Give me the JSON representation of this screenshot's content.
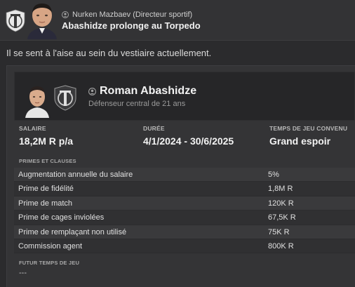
{
  "header": {
    "sender": "Nurken Mazbaev  (Directeur sportif)",
    "subject": "Abashidze prolonge au Torpedo"
  },
  "intro": "Il se sent à l'aise au sein du vestiaire actuellement.",
  "player": {
    "name": "Roman Abashidze",
    "description": "Défenseur central de 21 ans"
  },
  "contract": {
    "salary_label": "SALAIRE",
    "salary_value": "18,2M R p/a",
    "duration_label": "DURÉE",
    "duration_value": "4/1/2024 - 30/6/2025",
    "playtime_label": "TEMPS DE JEU CONVENU",
    "playtime_value": "Grand espoir"
  },
  "clauses": {
    "section_label": "PRIMES ET CLAUSES",
    "rows": [
      {
        "name": "Augmentation annuelle du salaire",
        "value": "5%"
      },
      {
        "name": "Prime de fidélité",
        "value": "1,8M R"
      },
      {
        "name": "Prime de match",
        "value": "120K R"
      },
      {
        "name": "Prime de cages inviolées",
        "value": "67,5K R"
      },
      {
        "name": "Prime de remplaçant non utilisé",
        "value": "75K R"
      },
      {
        "name": "Commission agent",
        "value": "800K R"
      }
    ]
  },
  "future": {
    "label": "FUTUR TEMPS DE JEU",
    "value": "---"
  },
  "icons": {
    "club_badge": "torpedo-club-badge",
    "person": "person-icon"
  },
  "colors": {
    "background": "#2b2b2d",
    "card": "#343436",
    "player_box": "#262628"
  }
}
